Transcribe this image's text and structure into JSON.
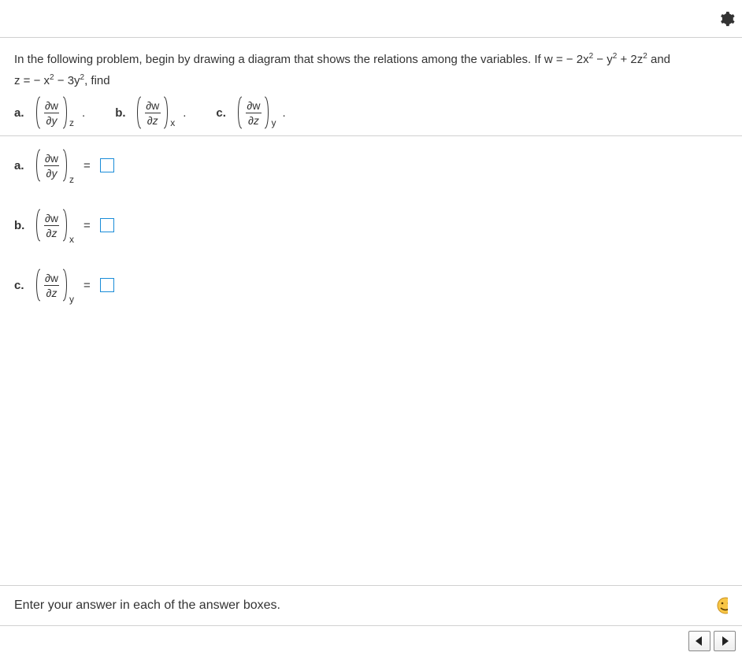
{
  "problem": {
    "intro": "In the following problem, begin by drawing a diagram that shows the relations among the variables. If w = − 2x",
    "intro2": " − y",
    "intro3": " + 2z",
    "and": " and",
    "line2a": "z = − x",
    "line2b": " − 3y",
    "line2c": ", find"
  },
  "parts": {
    "a": {
      "label": "a.",
      "num": "∂w",
      "den": "∂y",
      "sub": "z"
    },
    "b": {
      "label": "b.",
      "num": "∂w",
      "den": "∂z",
      "sub": "x"
    },
    "c": {
      "label": "c.",
      "num": "∂w",
      "den": "∂z",
      "sub": "y"
    }
  },
  "answers": {
    "a": {
      "label": "a.",
      "num": "∂w",
      "den": "∂y",
      "sub": "z",
      "eq": "="
    },
    "b": {
      "label": "b.",
      "num": "∂w",
      "den": "∂z",
      "sub": "x",
      "eq": "="
    },
    "c": {
      "label": "c.",
      "num": "∂w",
      "den": "∂z",
      "sub": "y",
      "eq": "="
    }
  },
  "footer": {
    "hint": "Enter your answer in each of the answer boxes."
  },
  "exp2": "2"
}
